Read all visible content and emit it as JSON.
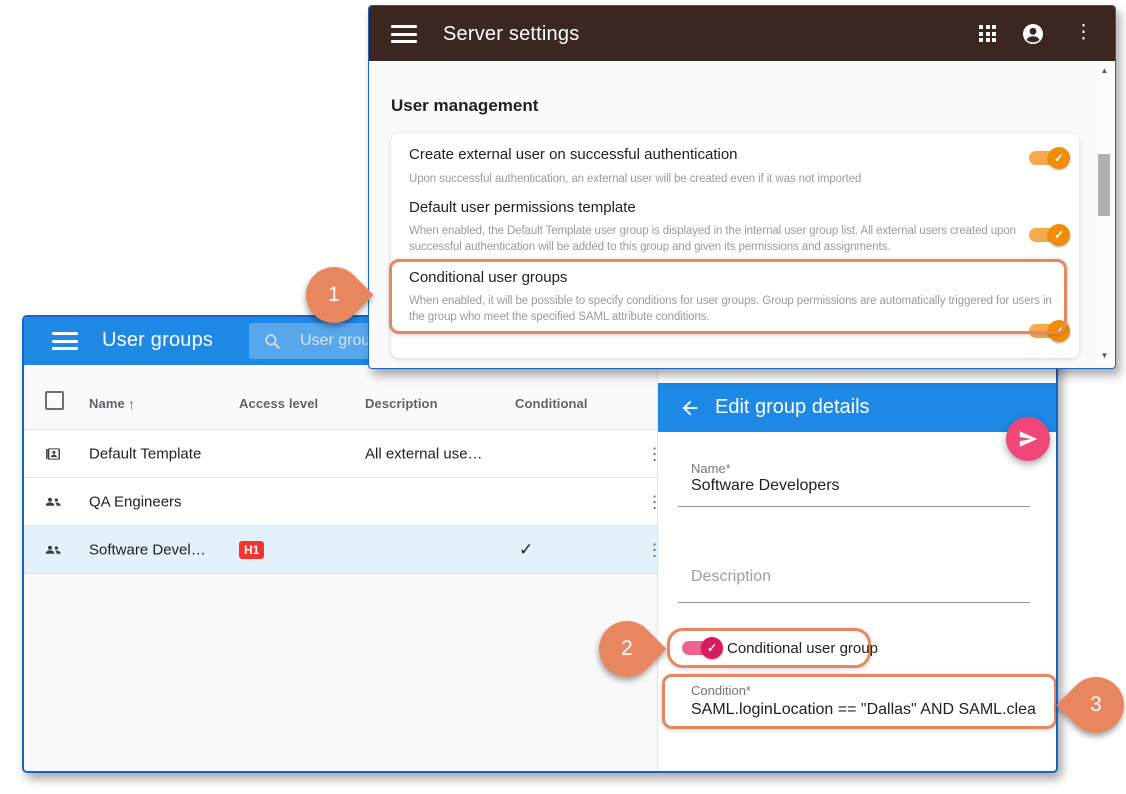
{
  "server_settings_window": {
    "title": "Server settings",
    "section_title": "User management",
    "settings": [
      {
        "title": "Create external user on successful authentication",
        "description": "Upon successful authentication, an external user will be created even if it was not imported",
        "toggle": "on"
      },
      {
        "title": "Default user permissions template",
        "description": "When enabled, the Default Template user group is displayed in the internal user group list. All external users created upon successful authentication will be added to this group and given its permissions and assignments.",
        "toggle": "on"
      },
      {
        "title": "Conditional user groups",
        "description": "When enabled, it will be possible to specify conditions for user groups. Group permissions are automatically triggered for users in the group who meet the specified SAML attribute conditions.",
        "toggle": "on"
      }
    ]
  },
  "user_groups_window": {
    "title": "User groups",
    "search_placeholder": "User group s",
    "table": {
      "columns": [
        "Name",
        "Access level",
        "Description",
        "Conditional"
      ],
      "sort_icon": "↑",
      "rows": [
        {
          "name": "Default Template",
          "access_level": "",
          "description": "All external use…",
          "conditional": ""
        },
        {
          "name": "QA Engineers",
          "access_level": "",
          "description": "",
          "conditional": ""
        },
        {
          "name": "Software Devel…",
          "access_level": "H1",
          "description": "",
          "conditional": "✓"
        }
      ]
    }
  },
  "edit_panel": {
    "title": "Edit group details",
    "name_label": "Name*",
    "name_value": "Software Developers",
    "description_placeholder": "Description",
    "toggle_label": "Conditional user group",
    "condition_label": "Condition*",
    "condition_value": "SAML.loginLocation == \"Dallas\" AND SAML.clea"
  },
  "annotations": {
    "step1": "1",
    "step2": "2",
    "step3": "3"
  },
  "colors": {
    "server_header": "#3C2622",
    "blue_header": "#1E88E5",
    "window_border": "#1565C0",
    "toggle_orange_track": "#F8A94E",
    "toggle_orange_thumb": "#F28C00",
    "toggle_pink_track": "#F06292",
    "toggle_pink_thumb": "#D81B60",
    "fab_pink": "#F04778",
    "badge_red": "#F5352B",
    "highlight_orange": "#E8875F",
    "selected_row": "#E3F1FB"
  }
}
